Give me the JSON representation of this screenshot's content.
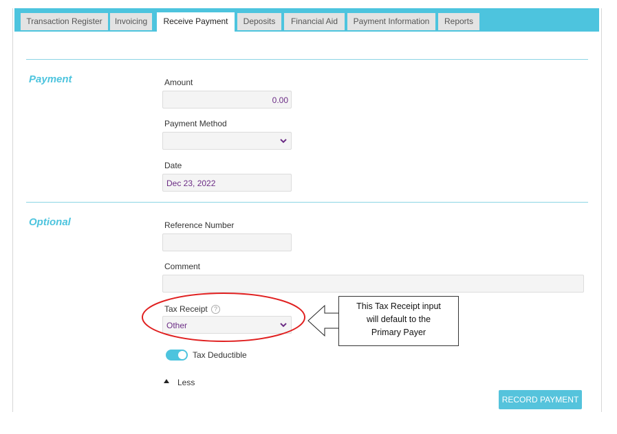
{
  "tabs": [
    {
      "label": "Transaction Register",
      "active": false
    },
    {
      "label": "Invoicing",
      "active": false
    },
    {
      "label": "Receive Payment",
      "active": true
    },
    {
      "label": "Deposits",
      "active": false
    },
    {
      "label": "Financial Aid",
      "active": false
    },
    {
      "label": "Payment Information",
      "active": false
    },
    {
      "label": "Reports",
      "active": false
    }
  ],
  "payment": {
    "title": "Payment",
    "amount_label": "Amount",
    "amount_value": "0.00",
    "method_label": "Payment Method",
    "method_value": "",
    "date_label": "Date",
    "date_value": "Dec 23, 2022"
  },
  "optional": {
    "title": "Optional",
    "reference_label": "Reference Number",
    "reference_value": "",
    "comment_label": "Comment",
    "comment_value": "",
    "tax_receipt_label": "Tax Receipt",
    "tax_receipt_help": "?",
    "tax_receipt_value": "Other",
    "tax_deductible_label": "Tax Deductible",
    "tax_deductible_on": true,
    "less_label": "Less"
  },
  "record_button": "RECORD PAYMENT",
  "annotation": {
    "line1": "This Tax Receipt input",
    "line2": "will default to the",
    "line3": "Primary Payer"
  },
  "colors": {
    "accent": "#4dc4de",
    "value_text": "#6b2c85",
    "highlight_circle": "#e02020"
  },
  "icons": {
    "select_caret": "chevron-down-icon",
    "help": "question-circle-icon",
    "less_toggle": "caret-up-icon",
    "callout_arrow": "arrow-left-icon"
  }
}
